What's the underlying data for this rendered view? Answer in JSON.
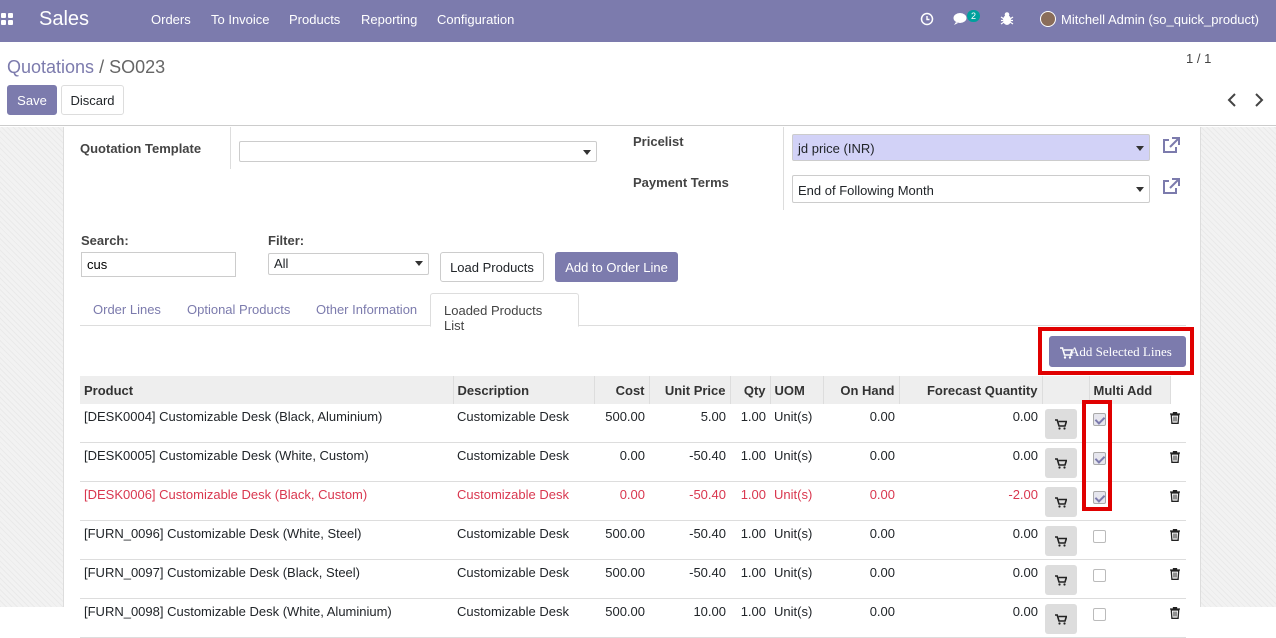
{
  "topbar": {
    "app_name": "Sales",
    "menu": [
      "Orders",
      "To Invoice",
      "Products",
      "Reporting",
      "Configuration"
    ],
    "messages_count": "2",
    "user": "Mitchell Admin (so_quick_product)"
  },
  "breadcrumb": {
    "parent": "Quotations",
    "separator": "/",
    "current": "SO023"
  },
  "actions": {
    "save": "Save",
    "discard": "Discard"
  },
  "pager": {
    "value": "1 / 1"
  },
  "form": {
    "quotation_template_label": "Quotation Template",
    "quotation_template_value": "",
    "pricelist_label": "Pricelist",
    "pricelist_value": "jd price (INR)",
    "payment_terms_label": "Payment Terms",
    "payment_terms_value": "End of Following Month"
  },
  "search": {
    "search_label": "Search:",
    "search_value": "cus",
    "filter_label": "Filter:",
    "filter_value": "All",
    "load_products": "Load Products",
    "add_to_order_line": "Add to Order Line"
  },
  "tabs": [
    "Order Lines",
    "Optional Products",
    "Other Information",
    "Loaded Products List"
  ],
  "add_selected_lines": "Add Selected Lines",
  "table": {
    "headers": [
      "Product",
      "Description",
      "Cost",
      "Unit Price",
      "Qty",
      "UOM",
      "On Hand",
      "Forecast Quantity",
      "",
      "Multi Add"
    ],
    "rows": [
      {
        "product": "[DESK0004] Customizable Desk (Black, Aluminium)",
        "description": "Customizable Desk",
        "cost": "500.00",
        "unit_price": "5.00",
        "qty": "1.00",
        "uom": "Unit(s)",
        "on_hand": "0.00",
        "forecast": "0.00",
        "checked": true,
        "warning": false
      },
      {
        "product": "[DESK0005] Customizable Desk (White, Custom)",
        "description": "Customizable Desk",
        "cost": "0.00",
        "unit_price": "-50.40",
        "qty": "1.00",
        "uom": "Unit(s)",
        "on_hand": "0.00",
        "forecast": "0.00",
        "checked": true,
        "warning": false
      },
      {
        "product": "[DESK0006] Customizable Desk (Black, Custom)",
        "description": "Customizable Desk",
        "cost": "0.00",
        "unit_price": "-50.40",
        "qty": "1.00",
        "uom": "Unit(s)",
        "on_hand": "0.00",
        "forecast": "-2.00",
        "checked": true,
        "warning": true
      },
      {
        "product": "[FURN_0096] Customizable Desk (White, Steel)",
        "description": "Customizable Desk",
        "cost": "500.00",
        "unit_price": "-50.40",
        "qty": "1.00",
        "uom": "Unit(s)",
        "on_hand": "0.00",
        "forecast": "0.00",
        "checked": false,
        "warning": false
      },
      {
        "product": "[FURN_0097] Customizable Desk (Black, Steel)",
        "description": "Customizable Desk",
        "cost": "500.00",
        "unit_price": "-50.40",
        "qty": "1.00",
        "uom": "Unit(s)",
        "on_hand": "0.00",
        "forecast": "0.00",
        "checked": false,
        "warning": false
      },
      {
        "product": "[FURN_0098] Customizable Desk (White, Aluminium)",
        "description": "Customizable Desk",
        "cost": "500.00",
        "unit_price": "10.00",
        "qty": "1.00",
        "uom": "Unit(s)",
        "on_hand": "0.00",
        "forecast": "0.00",
        "checked": false,
        "warning": false
      }
    ]
  },
  "colors": {
    "brand": "#7c7bad",
    "warning": "#d9374f",
    "highlight": "#e00000",
    "badge": "#00a09d"
  },
  "icons": [
    "apps-grid-icon",
    "clock-icon",
    "chat-icon",
    "bug-icon",
    "external-link-icon",
    "cart-icon",
    "trash-icon",
    "chevron-left-icon",
    "chevron-right-icon"
  ]
}
